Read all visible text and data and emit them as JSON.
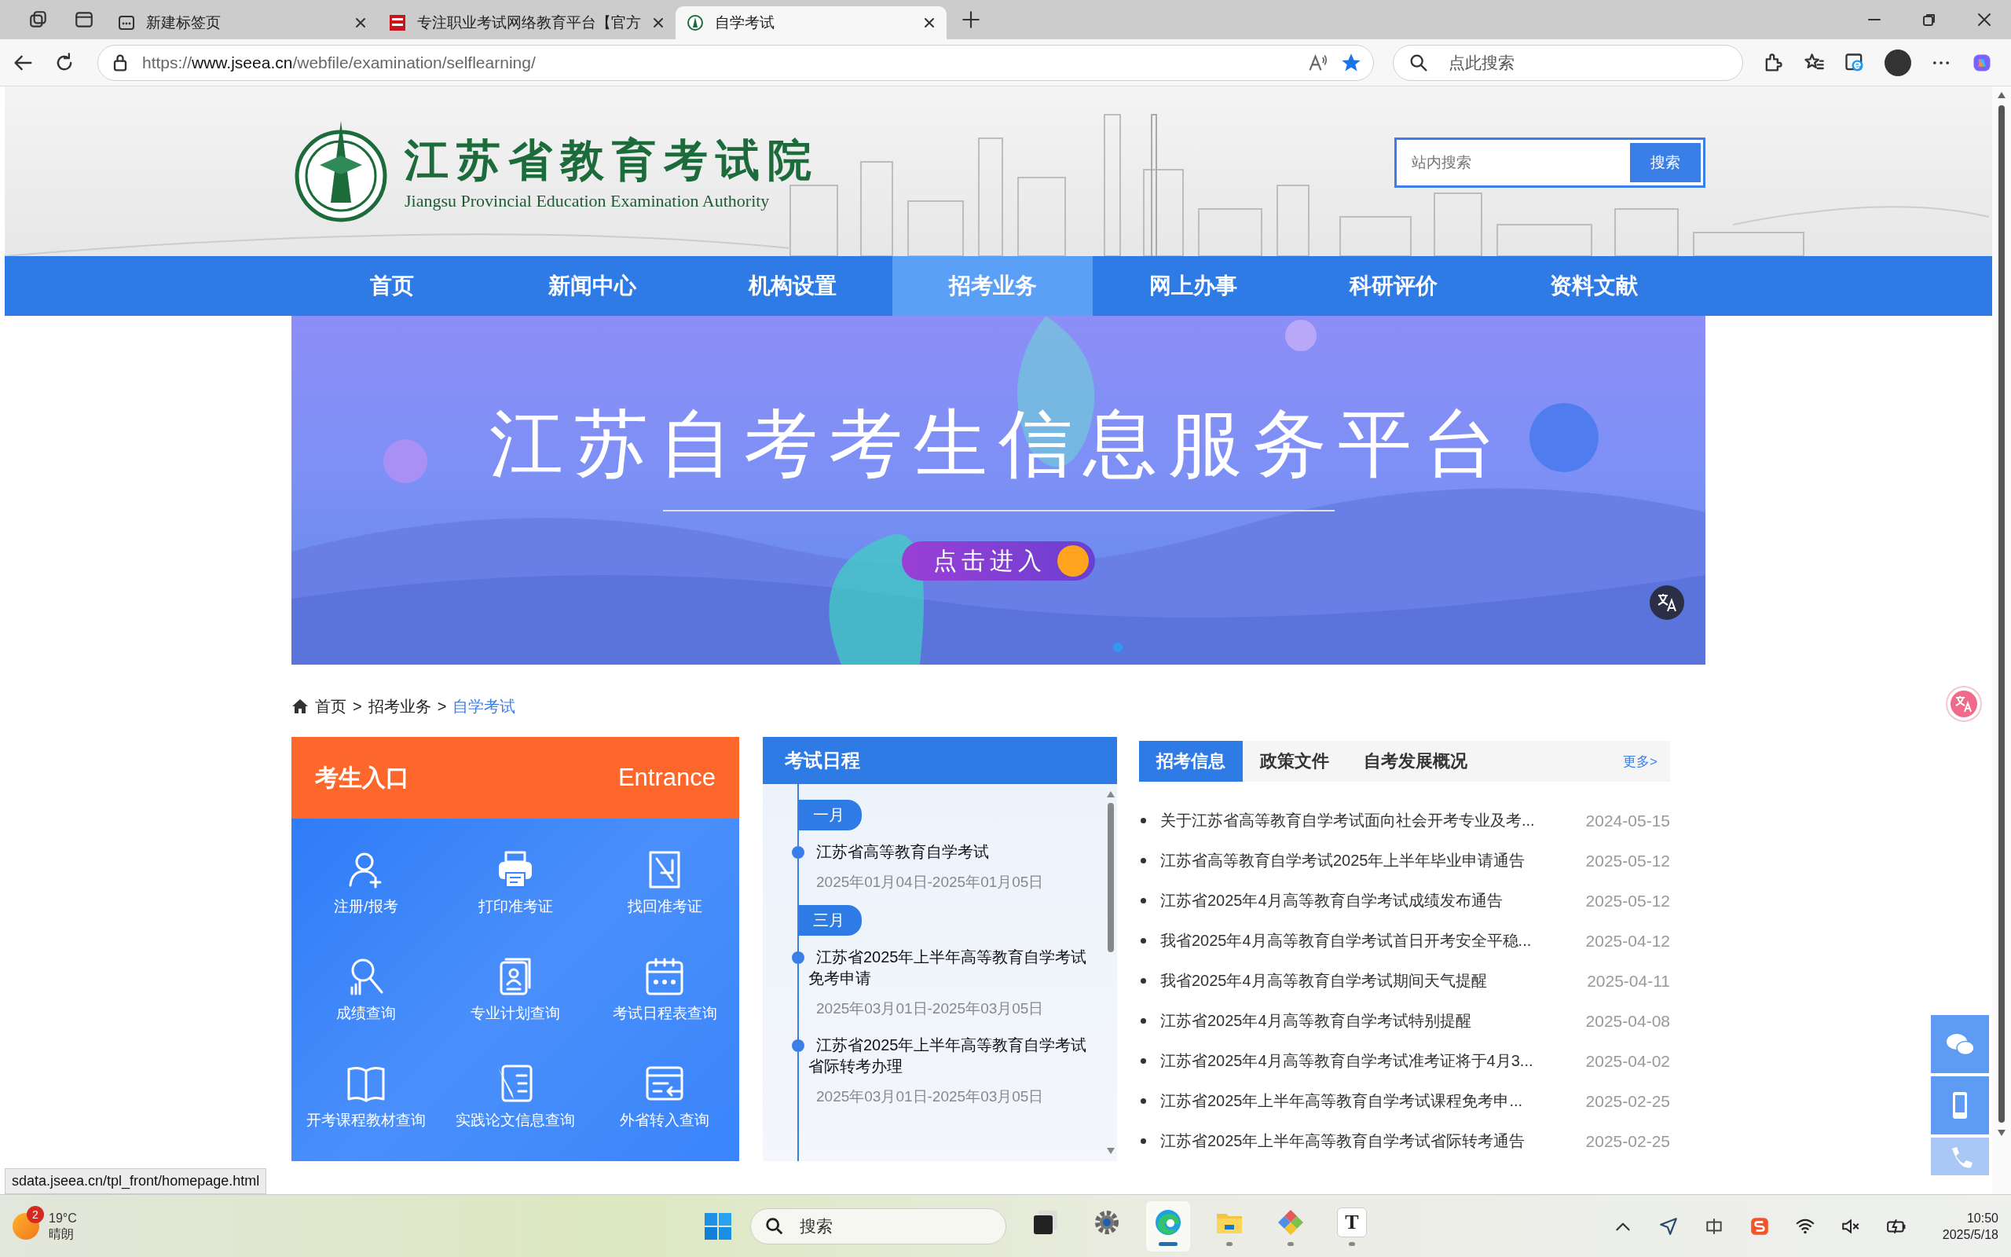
{
  "browser": {
    "tabs": [
      {
        "kind": "newtab",
        "title": "新建标签页",
        "selected": false
      },
      {
        "kind": "site-red",
        "title": "专注职业考试网络教育平台【官方",
        "selected": false
      },
      {
        "kind": "site-green",
        "title": "自学考试",
        "selected": true
      }
    ],
    "url": {
      "scheme": "https://",
      "host": "www.jseea.cn",
      "path": "/webfile/examination/selflearning/"
    },
    "search_placeholder": "点此搜索"
  },
  "site": {
    "logo_cn": "江苏省教育考试院",
    "logo_en": "Jiangsu Provincial Education Examination Authority",
    "search": {
      "placeholder": "站内搜索",
      "button": "搜索"
    },
    "nav": [
      {
        "label": "首页",
        "selected": false
      },
      {
        "label": "新闻中心",
        "selected": false
      },
      {
        "label": "机构设置",
        "selected": false
      },
      {
        "label": "招考业务",
        "selected": true
      },
      {
        "label": "网上办事",
        "selected": false
      },
      {
        "label": "科研评价",
        "selected": false
      },
      {
        "label": "资料文献",
        "selected": false
      }
    ],
    "banner": {
      "title": "江苏自考考生信息服务平台",
      "button": "点击进入"
    },
    "breadcrumb": {
      "items": [
        {
          "label": "首页",
          "selected": false
        },
        {
          "label": "招考业务",
          "selected": false
        },
        {
          "label": "自学考试",
          "selected": true
        }
      ],
      "separators": [
        ">",
        ">"
      ]
    },
    "entrance": {
      "title": "考生入口",
      "subtitle": "Entrance",
      "items": [
        "注册/报考",
        "打印准考证",
        "找回准考证",
        "成绩查询",
        "专业计划查询",
        "考试日程表查询",
        "开考课程教材查询",
        "实践论文信息查询",
        "外省转入查询"
      ]
    },
    "schedule": {
      "title": "考试日程",
      "groups": [
        {
          "month": "一月",
          "events": [
            {
              "title": "江苏省高等教育自学考试",
              "dates": "2025年01月04日-2025年01月05日"
            }
          ]
        },
        {
          "month": "三月",
          "events": [
            {
              "title": "江苏省2025年上半年高等教育自学考试免考申请",
              "dates": "2025年03月01日-2025年03月05日"
            },
            {
              "title": "江苏省2025年上半年高等教育自学考试省际转考办理",
              "dates": "2025年03月01日-2025年03月05日"
            }
          ]
        }
      ]
    },
    "news": {
      "tabs": [
        {
          "label": "招考信息",
          "selected": true
        },
        {
          "label": "政策文件",
          "selected": false
        },
        {
          "label": "自考发展概况",
          "selected": false
        }
      ],
      "more": "更多>",
      "items": [
        {
          "title": "关于江苏省高等教育自学考试面向社会开考专业及考...",
          "date": "2024-05-15"
        },
        {
          "title": "江苏省高等教育自学考试2025年上半年毕业申请通告",
          "date": "2025-05-12"
        },
        {
          "title": "江苏省2025年4月高等教育自学考试成绩发布通告",
          "date": "2025-05-12"
        },
        {
          "title": "我省2025年4月高等教育自学考试首日开考安全平稳...",
          "date": "2025-04-12"
        },
        {
          "title": "我省2025年4月高等教育自学考试期间天气提醒",
          "date": "2025-04-11"
        },
        {
          "title": "江苏省2025年4月高等教育自学考试特别提醒",
          "date": "2025-04-08"
        },
        {
          "title": "江苏省2025年4月高等教育自学考试准考证将于4月3...",
          "date": "2025-04-02"
        },
        {
          "title": "江苏省2025年上半年高等教育自学考试课程免考申...",
          "date": "2025-02-25"
        },
        {
          "title": "江苏省2025年上半年高等教育自学考试省际转考通告",
          "date": "2025-02-25"
        }
      ]
    }
  },
  "status_url": "sdata.jseea.cn/tpl_front/homepage.html",
  "taskbar": {
    "weather": {
      "badge": "2",
      "temp": "19°C",
      "condition": "晴朗"
    },
    "search_placeholder": "搜索",
    "apps": [
      {
        "kind": "taskview",
        "selected": false,
        "running": false
      },
      {
        "kind": "settings",
        "selected": false,
        "running": false
      },
      {
        "kind": "edge",
        "selected": true,
        "running": true
      },
      {
        "kind": "files",
        "selected": false,
        "running": true
      },
      {
        "kind": "tool",
        "selected": false,
        "running": true
      },
      {
        "kind": "text",
        "glyph": "T",
        "selected": false,
        "running": true
      }
    ],
    "clock": {
      "time": "10:50",
      "date": "2025/5/18"
    }
  }
}
